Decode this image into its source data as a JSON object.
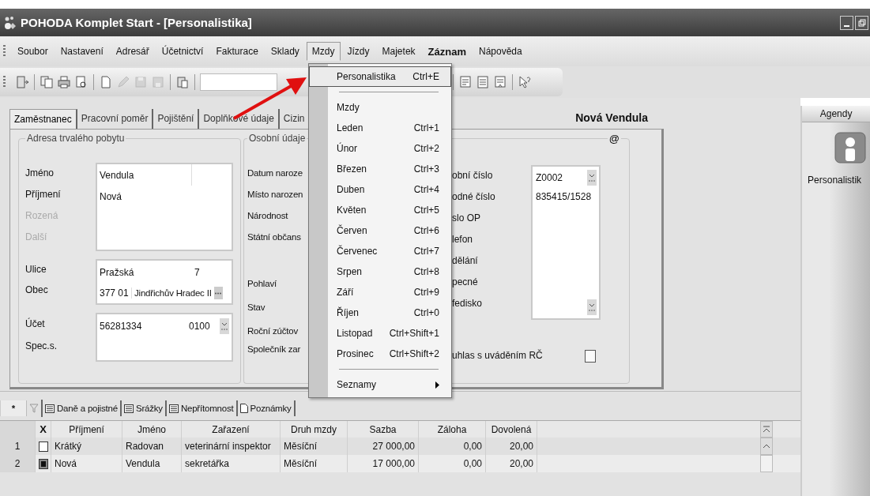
{
  "window": {
    "title": "POHODA Komplet Start - [Personalistika]"
  },
  "menu_bar": [
    {
      "label": "Soubor",
      "selected": false,
      "bold": false
    },
    {
      "label": "Nastavení",
      "selected": false,
      "bold": false
    },
    {
      "label": "Adresář",
      "selected": false,
      "bold": false
    },
    {
      "label": "Účetnictví",
      "selected": false,
      "bold": false
    },
    {
      "label": "Fakturace",
      "selected": false,
      "bold": false
    },
    {
      "label": "Sklady",
      "selected": false,
      "bold": false
    },
    {
      "label": "Mzdy",
      "selected": true,
      "bold": false
    },
    {
      "label": "Jízdy",
      "selected": false,
      "bold": false
    },
    {
      "label": "Majetek",
      "selected": false,
      "bold": false
    },
    {
      "label": "Záznam",
      "selected": false,
      "bold": true
    },
    {
      "label": "Nápověda",
      "selected": false,
      "bold": false
    }
  ],
  "dropdown": [
    {
      "kind": "item",
      "label": "Personalistika",
      "shortcut": "Ctrl+E",
      "selected": true
    },
    {
      "kind": "separator"
    },
    {
      "kind": "item",
      "label": "Mzdy",
      "selected": false
    },
    {
      "kind": "item",
      "label": "Leden",
      "shortcut": "Ctrl+1",
      "selected": false
    },
    {
      "kind": "item",
      "label": "Únor",
      "shortcut": "Ctrl+2",
      "selected": false
    },
    {
      "kind": "item",
      "label": "Březen",
      "shortcut": "Ctrl+3",
      "selected": false
    },
    {
      "kind": "item",
      "label": "Duben",
      "shortcut": "Ctrl+4",
      "selected": false
    },
    {
      "kind": "item",
      "label": "Květen",
      "shortcut": "Ctrl+5",
      "selected": false
    },
    {
      "kind": "item",
      "label": "Červen",
      "shortcut": "Ctrl+6",
      "selected": false
    },
    {
      "kind": "item",
      "label": "Červenec",
      "shortcut": "Ctrl+7",
      "selected": false
    },
    {
      "kind": "item",
      "label": "Srpen",
      "shortcut": "Ctrl+8",
      "selected": false
    },
    {
      "kind": "item",
      "label": "Září",
      "shortcut": "Ctrl+9",
      "selected": false
    },
    {
      "kind": "item",
      "label": "Říjen",
      "shortcut": "Ctrl+0",
      "selected": false
    },
    {
      "kind": "item",
      "label": "Listopad",
      "shortcut": "Ctrl+Shift+1",
      "selected": false
    },
    {
      "kind": "item",
      "label": "Prosinec",
      "shortcut": "Ctrl+Shift+2",
      "selected": false
    },
    {
      "kind": "separator"
    },
    {
      "kind": "submenu",
      "label": "Seznamy",
      "selected": false
    }
  ],
  "form": {
    "tabs": [
      {
        "label": "Zaměstnanec",
        "selected": true
      },
      {
        "label": "Pracovní poměr",
        "selected": false
      },
      {
        "label": "Pojištění",
        "selected": false
      },
      {
        "label": "Doplňkové údaje",
        "selected": false
      },
      {
        "label": "Cizin",
        "selected": false
      }
    ],
    "title": "Nová Vendula",
    "email_marker": "@",
    "address": {
      "legend": "Adresa trvalého pobytu",
      "labels": [
        {
          "text": "Jméno",
          "disabled": false
        },
        {
          "text": "Příjmení",
          "disabled": false
        },
        {
          "text": "Rozená",
          "disabled": true
        },
        {
          "text": "Další",
          "disabled": true
        }
      ],
      "first_name": "Vendula",
      "last_name": "Nová",
      "street_label": "Ulice",
      "street": "Pražská",
      "house_number": "7",
      "city_label": "Obec",
      "zip": "377 01",
      "city": "Jindřichův Hradec II",
      "account_label": "Účet",
      "account": "56281334",
      "bank_code": "0100",
      "spec_label": "Spec.s."
    },
    "personal": {
      "legend": "Osobní údaje",
      "labels": [
        "Datum naroze",
        "Místo narozen",
        "Národnost",
        "Státní občans",
        "Pohlaví",
        "Stav",
        "Roční zúčtov",
        "Společník zar"
      ]
    },
    "ids": {
      "labels": [
        "obní číslo",
        "odné číslo",
        "slo OP",
        "lefon",
        "dělání",
        "pecné",
        "fedisko"
      ],
      "personal_number": "Z0002",
      "birth_number": "835415/1528",
      "consent_label": "uhlas s uváděním RČ",
      "consent_checked": false
    }
  },
  "detail_tabs": [
    {
      "kind": "star",
      "label": "*",
      "selected": true
    },
    {
      "kind": "filter",
      "selected": false
    },
    {
      "kind": "list",
      "label": "Daně a pojistné",
      "selected": false
    },
    {
      "kind": "list",
      "label": "Srážky",
      "selected": false
    },
    {
      "kind": "list",
      "label": "Nepřítomnost",
      "selected": false
    },
    {
      "kind": "note",
      "label": "Poznámky",
      "selected": false
    }
  ],
  "table": {
    "checkbox_column": "X",
    "columns": [
      "Příjmení",
      "Jméno",
      "Zařazení",
      "Druh mzdy",
      "Sazba",
      "Záloha",
      "Dovolená"
    ],
    "rows": [
      {
        "number": "1",
        "checked": false,
        "cells": [
          "Krátký",
          "Radovan",
          "veterinární inspektor",
          "Měsíční",
          "27 000,00",
          "0,00",
          "20,00"
        ]
      },
      {
        "number": "2",
        "checked": true,
        "cells": [
          "Nová",
          "Vendula",
          "sekretářka",
          "Měsíční",
          "17 000,00",
          "0,00",
          "20,00"
        ]
      }
    ]
  },
  "sidebar": {
    "title": "Agendy",
    "items": [
      {
        "label": "Personalistik"
      }
    ]
  }
}
